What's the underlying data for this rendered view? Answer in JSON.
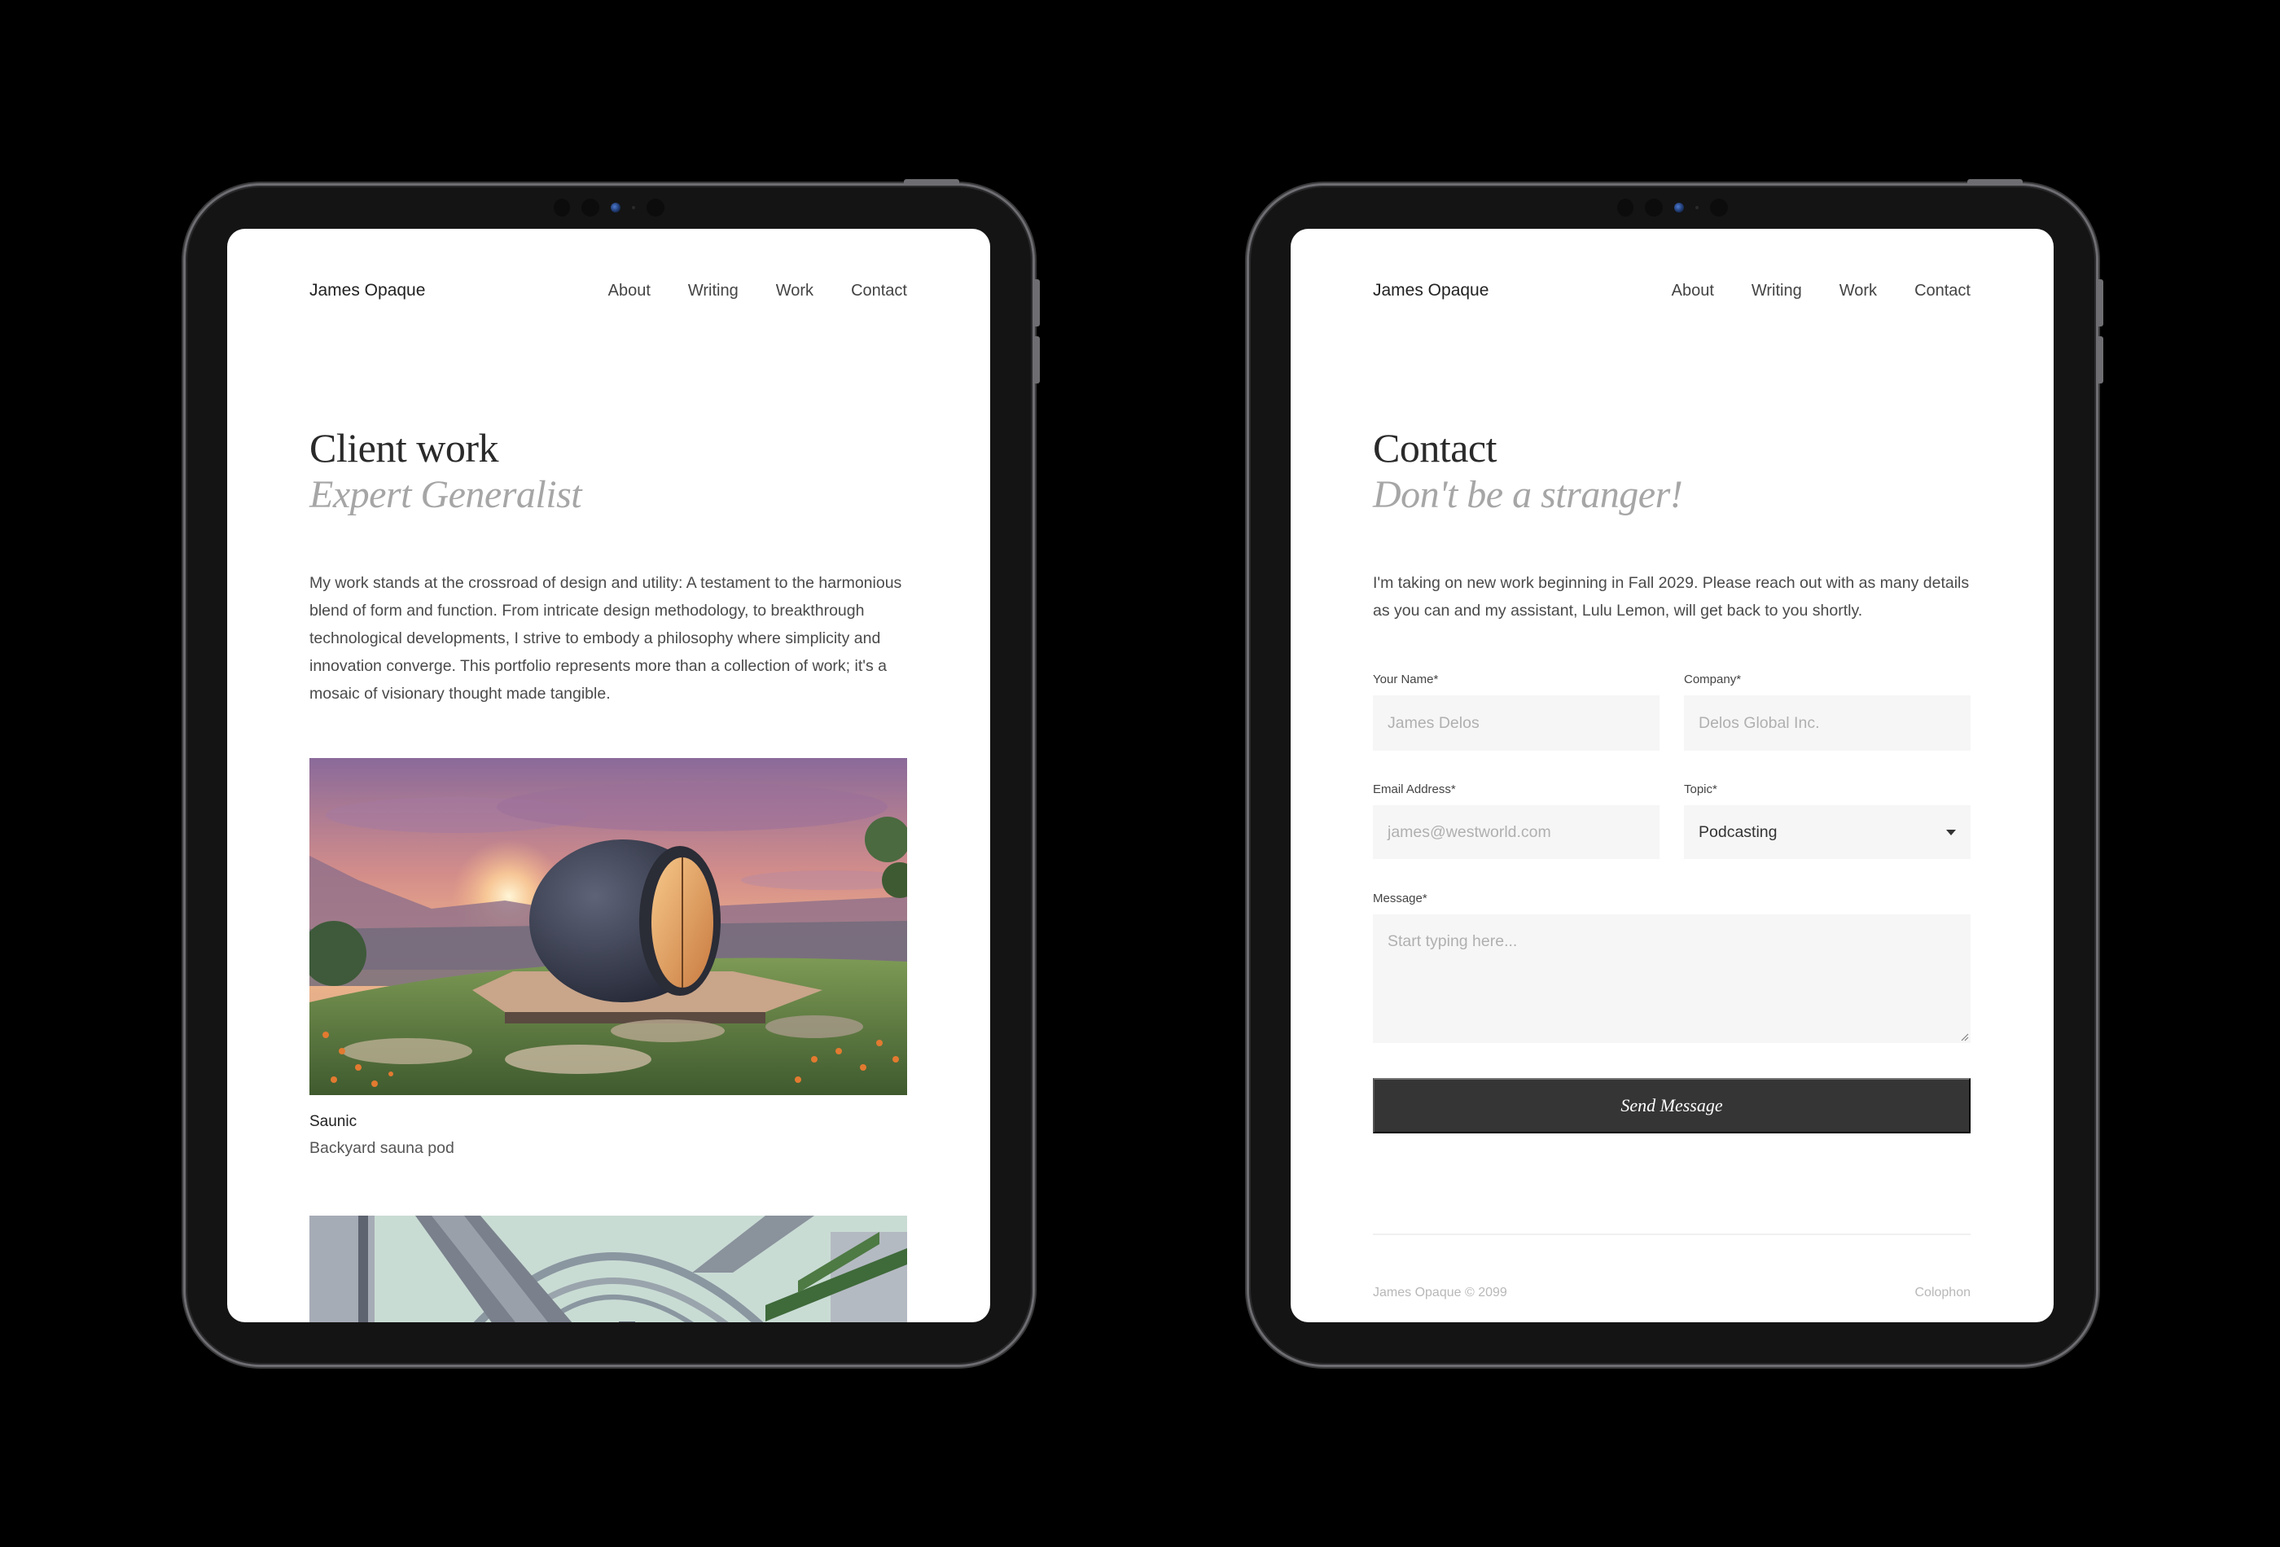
{
  "site": {
    "brand": "James Opaque",
    "nav": [
      "About",
      "Writing",
      "Work",
      "Contact"
    ]
  },
  "work_page": {
    "title": "Client work",
    "subtitle": "Expert Generalist",
    "intro": "My work stands at the crossroad of design and utility: A testament to the harmonious blend of form and function. From intricate design methodology, to breakthrough technological developments, I strive to embody a philosophy where simplicity and innovation converge. This portfolio represents more than a collection of work; it's a mosaic of visionary thought made tangible.",
    "projects": [
      {
        "name": "Saunic",
        "description": "Backyard sauna pod",
        "image": "sauna-pod-sunset-illustration"
      },
      {
        "name": "",
        "description": "",
        "image": "greenhouse-arcade-illustration"
      }
    ]
  },
  "contact_page": {
    "title": "Contact",
    "subtitle": "Don't be a stranger!",
    "intro": "I'm taking on new work beginning in Fall 2029. Please reach out with as many details as you can and my assistant, Lulu Lemon, will get back to you shortly.",
    "form": {
      "name_label": "Your Name*",
      "name_placeholder": "James Delos",
      "company_label": "Company*",
      "company_placeholder": "Delos Global Inc.",
      "email_label": "Email Address*",
      "email_placeholder": "james@westworld.com",
      "topic_label": "Topic*",
      "topic_value": "Podcasting",
      "message_label": "Message*",
      "message_placeholder": "Start typing here...",
      "submit_label": "Send Message"
    },
    "footer": {
      "copyright": "James Opaque © 2099",
      "colophon": "Colophon"
    }
  },
  "colors": {
    "text_primary": "#2a2a2a",
    "text_muted": "#a6a6a6",
    "field_bg": "#f6f6f6",
    "button_bg": "#353535",
    "device_bezel": "#141414"
  }
}
